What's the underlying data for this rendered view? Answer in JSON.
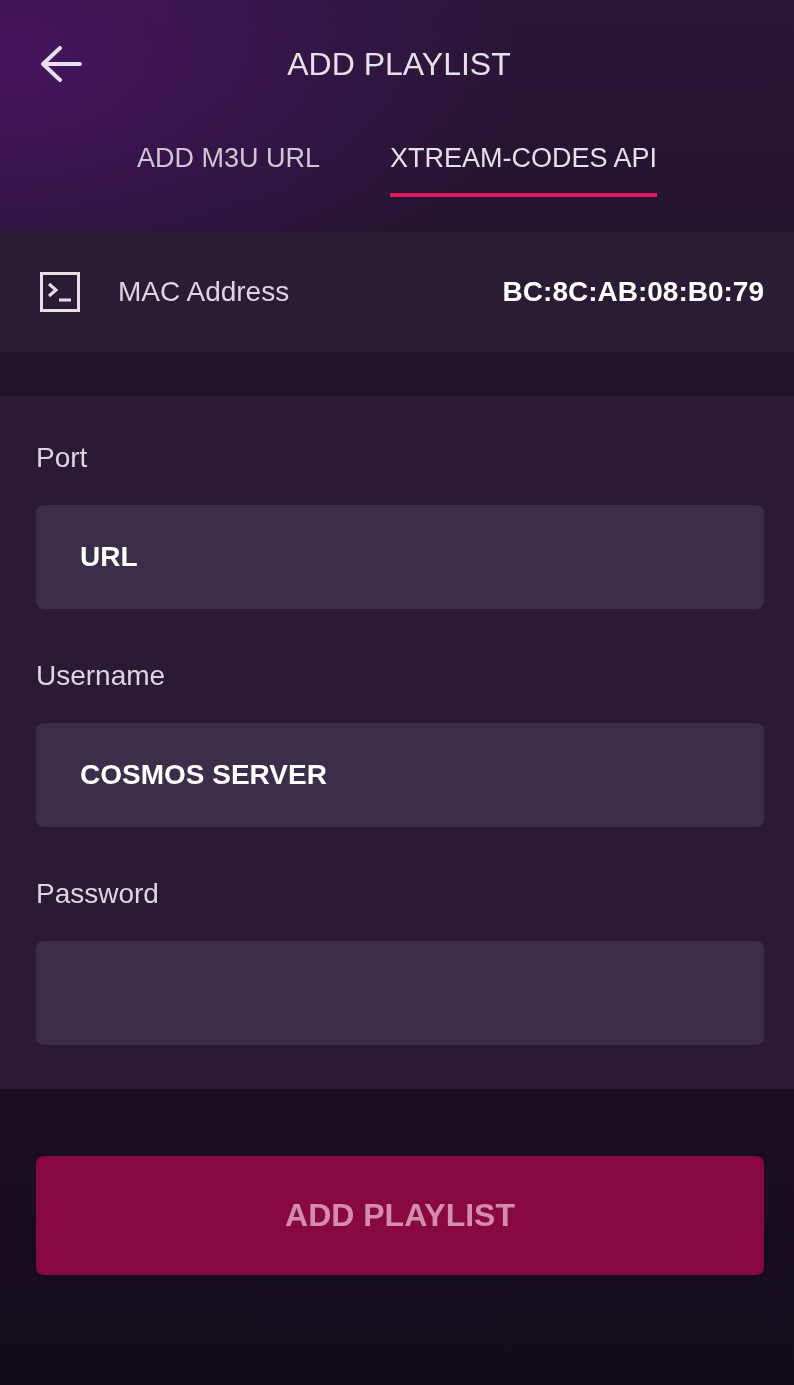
{
  "header": {
    "title": "ADD PLAYLIST"
  },
  "tabs": [
    {
      "label": "ADD M3U URL",
      "selected": false
    },
    {
      "label": "XTREAM-CODES API",
      "selected": true
    }
  ],
  "mac_address": {
    "label": "MAC Address",
    "value": "BC:8C:AB:08:B0:79"
  },
  "form": {
    "fields": [
      {
        "label": "Port",
        "value": "URL"
      },
      {
        "label": "Username",
        "value": "COSMOS SERVER"
      },
      {
        "label": "Password"
      }
    ]
  },
  "submit_button": {
    "label": "ADD PLAYLIST",
    "disabled": true
  }
}
